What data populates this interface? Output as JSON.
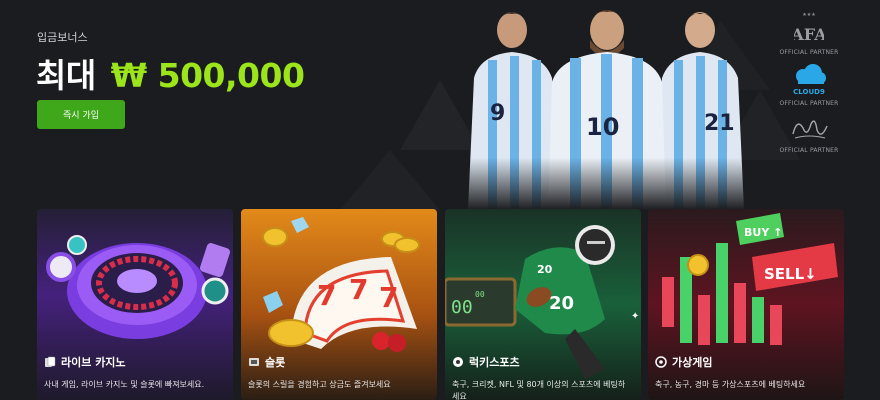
{
  "hero": {
    "subtitle": "입금보너스",
    "title_prefix": "최대",
    "amount": "₩ 500,000",
    "join_label": "즉시 가입"
  },
  "partners": [
    {
      "name": "AFA",
      "label": "OFFICIAL PARTNER"
    },
    {
      "name": "CLOUD9",
      "label": "OFFICIAL PARTNER"
    },
    {
      "name": "signature",
      "label": "OFFICIAL PARTNER"
    }
  ],
  "players": [
    "9",
    "10",
    "21"
  ],
  "cards": [
    {
      "icon": "cards-icon",
      "title": "라이브 카지노",
      "desc": "사내 게임, 라이브 카지노 및 슬롯에 빠져보세요.",
      "bg": "#5a2a9e"
    },
    {
      "icon": "slot-icon",
      "title": "슬롯",
      "desc": "슬롯의 스릴을 경험하고 상금도 즐겨보세요",
      "bg": "#c26a10"
    },
    {
      "icon": "ball-icon",
      "title": "럭키스포츠",
      "desc": "축구, 크리켓, NFL 및 80개 이상의 스포츠에 베팅하",
      "desc2": "세요",
      "bg": "#145c34"
    },
    {
      "icon": "virtual-icon",
      "title": "가상게임",
      "desc": "축구, 농구, 경마 등 가상스포츠에 베팅하세요",
      "bg": "#7a1422"
    }
  ],
  "colors": {
    "accent": "#9be51a",
    "button": "#3fa71a",
    "background": "#1b1c1f"
  }
}
